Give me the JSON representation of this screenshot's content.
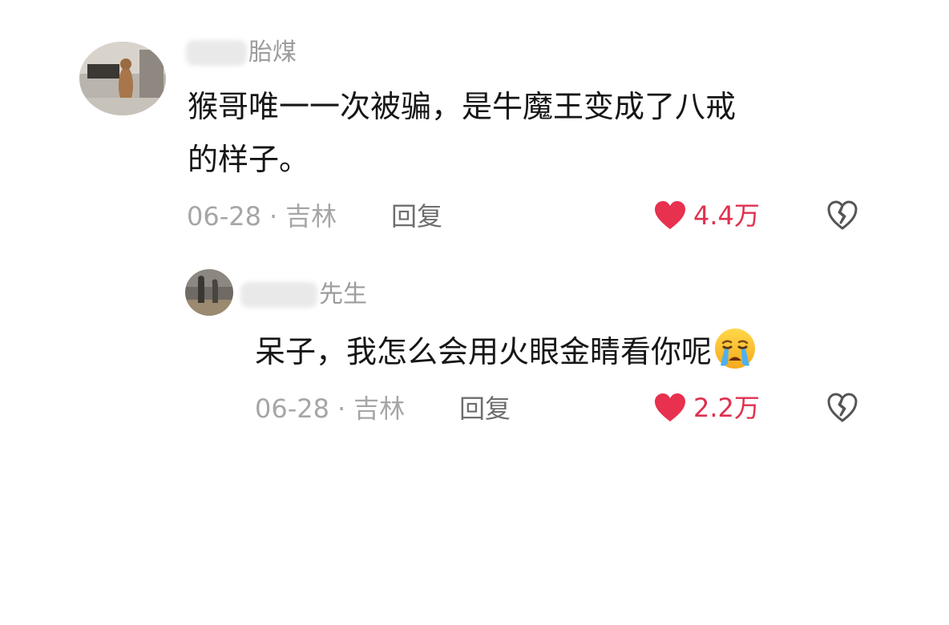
{
  "comments": [
    {
      "username_suffix": "胎煤",
      "text_line1": "猴哥唯一一次被骗，是牛魔王变成了八戒",
      "text_line2": "的样子。",
      "date": "06-28",
      "location": "吉林",
      "reply_label": "回复",
      "likes": "4.4万"
    },
    {
      "username_suffix": "先生",
      "text": "呆子，我怎么会用火眼金睛看你呢",
      "emoji": "crying-face-emoji",
      "date": "06-28",
      "location": "吉林",
      "reply_label": "回复",
      "likes": "2.2万"
    }
  ],
  "colors": {
    "like": "#e0304f",
    "meta": "#a6a6a6",
    "text": "#161616"
  },
  "icons": {
    "like": "heart-icon",
    "dislike": "broken-heart-icon"
  }
}
